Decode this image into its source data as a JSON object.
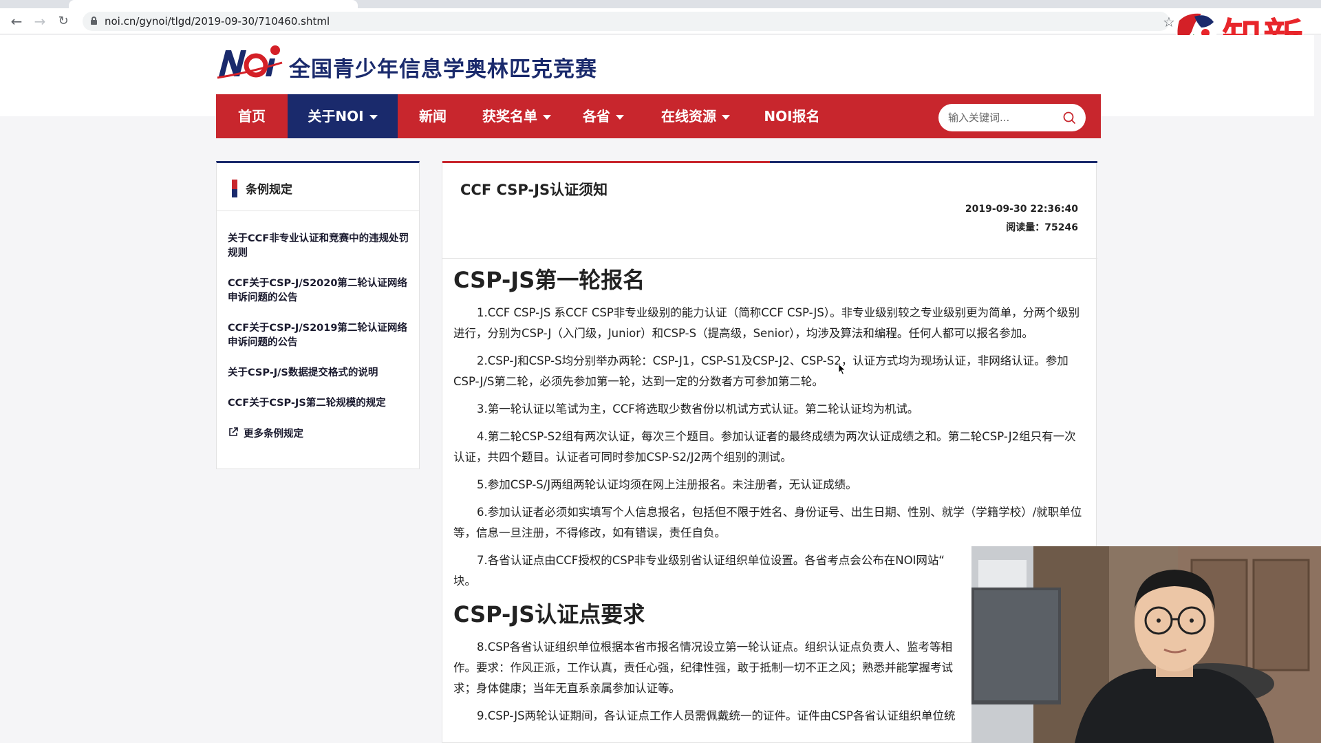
{
  "browser": {
    "url": "noi.cn/gynoi/tlgd/2019-09-30/710460.shtml"
  },
  "watermark": {
    "text": "知新"
  },
  "site": {
    "title": "全国青少年信息学奥林匹克竞赛"
  },
  "navbar": {
    "items": [
      {
        "label": "首页"
      },
      {
        "label": "关于NOI"
      },
      {
        "label": "新闻"
      },
      {
        "label": "获奖名单"
      },
      {
        "label": "各省"
      },
      {
        "label": "在线资源"
      },
      {
        "label": "NOI报名"
      }
    ],
    "search_placeholder": "输入关键词..."
  },
  "sidebar": {
    "title": "条例规定",
    "links": [
      {
        "label": "关于CCF非专业认证和竞赛中的违规处罚规则"
      },
      {
        "label": "CCF关于CSP-J/S2020第二轮认证网络申诉问题的公告"
      },
      {
        "label": "CCF关于CSP-J/S2019第二轮认证网络申诉问题的公告"
      },
      {
        "label": "关于CSP-J/S数据提交格式的说明"
      },
      {
        "label": "CCF关于CSP-JS第二轮规模的规定"
      }
    ],
    "more_label": "更多条例规定"
  },
  "article": {
    "title": "CCF CSP-JS认证须知",
    "date": "2019-09-30 22:36:40",
    "views": "阅读量：75246",
    "section1": "CSP-JS第一轮报名",
    "p1": "1.CCF CSP-JS 系CCF CSP非专业级别的能力认证（简称CCF CSP-JS）。非专业级别较之专业级别更为简单，分两个级别进行，分别为CSP-J（入门级，Junior）和CSP-S（提高级，Senior），均涉及算法和编程。任何人都可以报名参加。",
    "p2": "2.CSP-J和CSP-S均分别举办两轮：CSP-J1，CSP-S1及CSP-J2、CSP-S2，认证方式均为现场认证，非网络认证。参加CSP-J/S第二轮，必须先参加第一轮，达到一定的分数者方可参加第二轮。",
    "p3": "3.第一轮认证以笔试为主，CCF将选取少数省份以机试方式认证。第二轮认证均为机试。",
    "p4": "4.第二轮CSP-S2组有两次认证，每次三个题目。参加认证者的最终成绩为两次认证成绩之和。第二轮CSP-J2组只有一次认证，共四个题目。认证者可同时参加CSP-S2/J2两个组别的测试。",
    "p5": "5.参加CSP-S/J两组两轮认证均须在网上注册报名。未注册者，无认证成绩。",
    "p6": "6.参加认证者必须如实填写个人信息报名，包括但不限于姓名、身份证号、出生日期、性别、就学（学籍学校）/就职单位等，信息一旦注册，不得修改，如有错误，责任自负。",
    "p7": "7.各省认证点由CCF授权的CSP非专业级别省认证组织单位设置。各省考点会公布在NOI网站“",
    "p7_end": "块。",
    "section2": "CSP-JS认证点要求",
    "p8": "8.CSP各省认证组织单位根据本省市报名情况设立第一轮认证点。组织认证点负责人、监考等相",
    "p8_b": "作。要求：作风正派，工作认真，责任心强，纪律性强，敢于抵制一切不正之风；熟悉并能掌握考试",
    "p8_c": "求；身体健康；当年无直系亲属参加认证等。",
    "p9": "9.CSP-JS两轮认证期间，各认证点工作人员需佩戴统一的证件。证件由CSP各省认证组织单位统"
  },
  "colors": {
    "brand_red": "#c8262d",
    "brand_navy": "#1a2a6c"
  }
}
